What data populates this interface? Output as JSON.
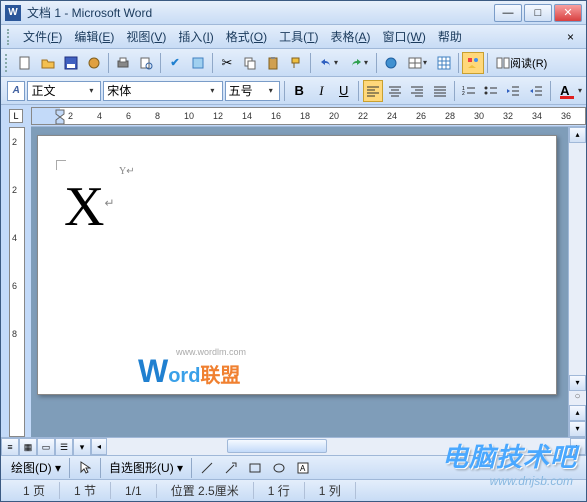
{
  "title": "文档 1 - Microsoft Word",
  "menus": [
    {
      "label": "文件",
      "key": "F"
    },
    {
      "label": "编辑",
      "key": "E"
    },
    {
      "label": "视图",
      "key": "V"
    },
    {
      "label": "插入",
      "key": "I"
    },
    {
      "label": "格式",
      "key": "O"
    },
    {
      "label": "工具",
      "key": "T"
    },
    {
      "label": "表格",
      "key": "A"
    },
    {
      "label": "窗口",
      "key": "W"
    },
    {
      "label": "帮助"
    }
  ],
  "toolbar_reading": "阅读(R)",
  "format": {
    "style_label": "正文",
    "font_label": "宋体",
    "size_label": "五号"
  },
  "ruler_ticks": [
    "2",
    "4",
    "6",
    "8",
    "10",
    "12",
    "14",
    "16",
    "18",
    "20",
    "22",
    "24",
    "26",
    "28",
    "30",
    "32",
    "34",
    "36"
  ],
  "vruler_ticks": [
    "2",
    "2",
    "4",
    "6",
    "8"
  ],
  "document": {
    "main_char": "X",
    "superscript": "Y"
  },
  "watermark": {
    "url": "www.wordlm.com",
    "w": "W",
    "ord": "ord",
    "lm": "联盟"
  },
  "drawbar": {
    "draw": "绘图(D)",
    "shapes": "自选图形(U)"
  },
  "status": {
    "page": "1 页",
    "section": "1 节",
    "pages": "1/1",
    "position": "位置 2.5厘米",
    "line": "1 行",
    "col": "1 列"
  },
  "overlay": {
    "brand": "电脑技术吧",
    "url": "www.dnjsb.com"
  }
}
